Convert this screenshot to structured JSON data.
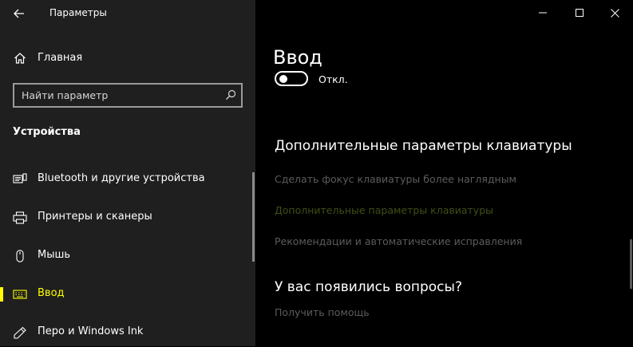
{
  "window": {
    "title": "Параметры"
  },
  "sidebar": {
    "home_label": "Главная",
    "search": {
      "placeholder": "Найти параметр"
    },
    "section_title": "Устройства",
    "items": [
      {
        "label": "Bluetooth и другие устройства",
        "icon": "bluetooth-devices-icon",
        "selected": false
      },
      {
        "label": "Принтеры и сканеры",
        "icon": "printer-icon",
        "selected": false
      },
      {
        "label": "Мышь",
        "icon": "mouse-icon",
        "selected": false
      },
      {
        "label": "Ввод",
        "icon": "keyboard-icon",
        "selected": true
      },
      {
        "label": "Перо и Windows Ink",
        "icon": "pen-icon",
        "selected": false
      }
    ]
  },
  "main": {
    "page_title": "Ввод",
    "toggle": {
      "state_label": "Откл.",
      "on": false
    },
    "keyboard_section": {
      "title": "Дополнительные параметры клавиатуры",
      "links": [
        "Сделать фокус клавиатуры более наглядным",
        "Дополнительные параметры клавиатуры",
        "Рекомендации и автоматические исправления"
      ]
    },
    "help_section": {
      "title": "У вас появились вопросы?",
      "link": "Получить помощь"
    }
  },
  "colors": {
    "sidebar_bg": "#1f1f1f",
    "main_bg": "#000000",
    "accent_selected": "#ffff00",
    "link_gray": "#5c5c5c",
    "link_olive": "#3f4f16"
  }
}
